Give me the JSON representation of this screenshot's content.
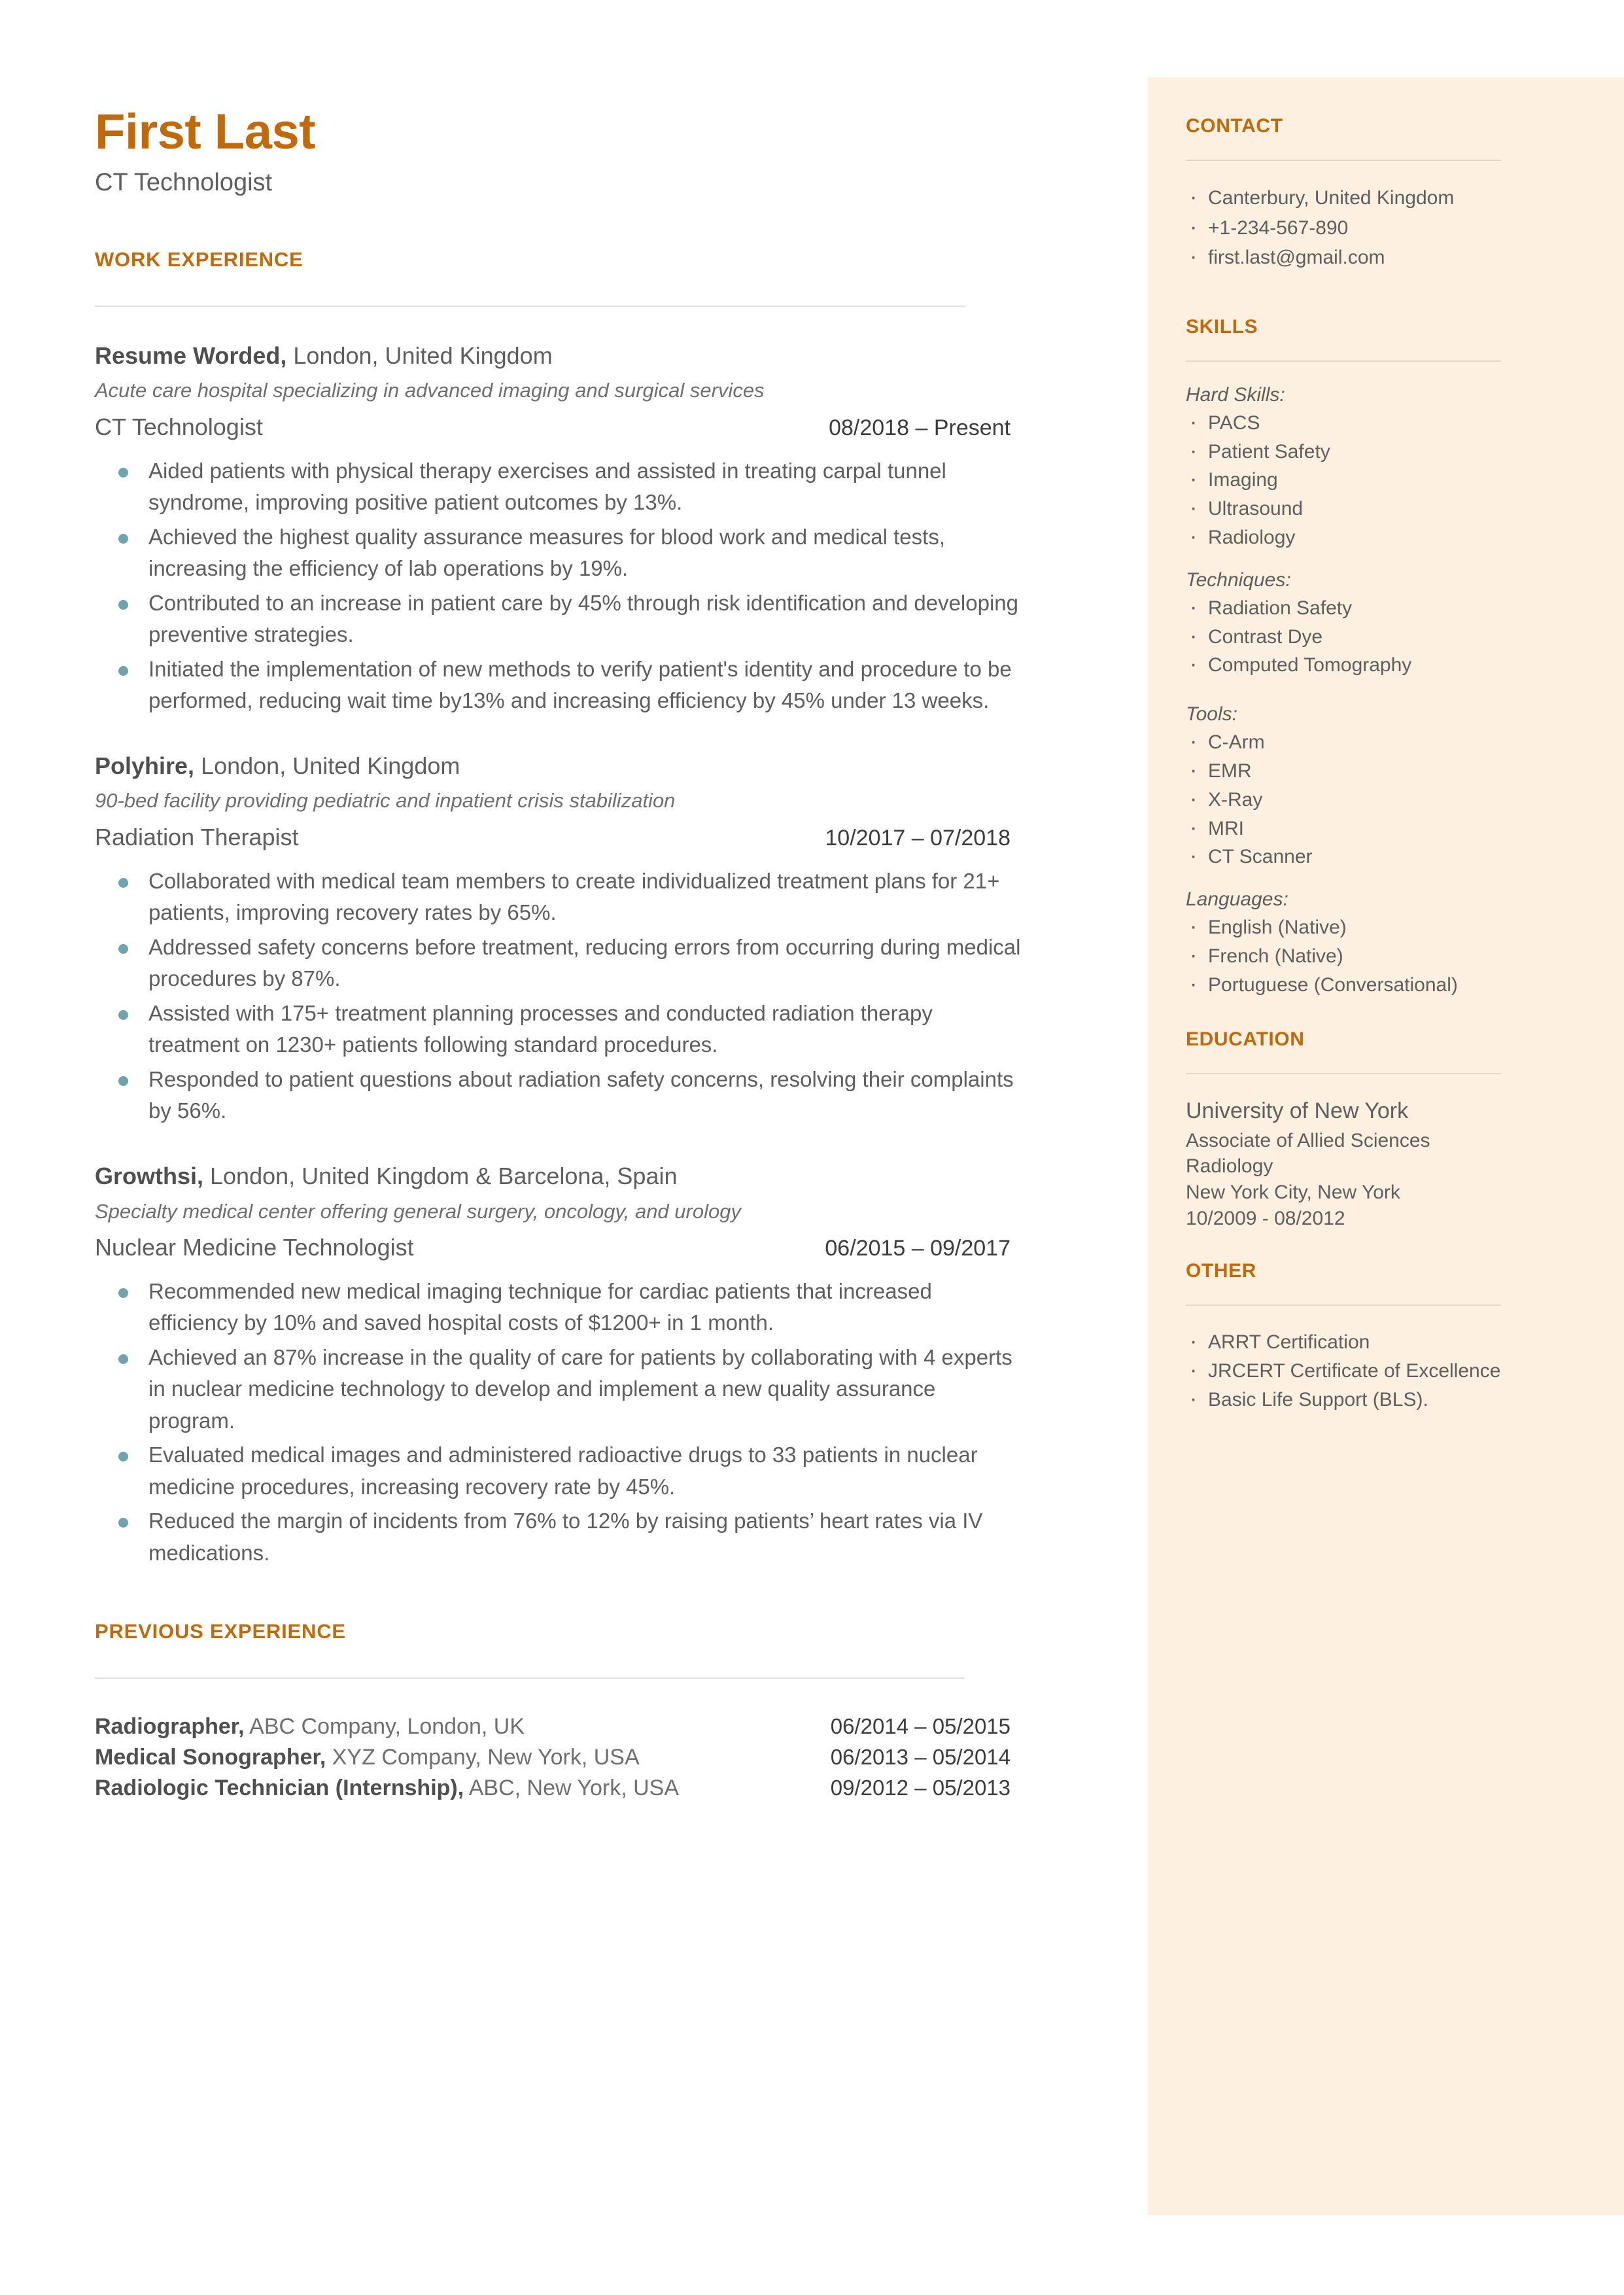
{
  "header": {
    "name": "First Last",
    "role": "CT Technologist"
  },
  "main": {
    "work_heading": "WORK EXPERIENCE",
    "previous_heading": "PREVIOUS EXPERIENCE",
    "jobs": [
      {
        "company": "Resume Worded,",
        "location": " London, United Kingdom",
        "description": "Acute care hospital specializing in advanced imaging and surgical services",
        "title": "CT Technologist",
        "dates": "08/2018 – Present",
        "bullets": [
          "Aided patients with physical therapy exercises and assisted in treating carpal tunnel syndrome, improving positive patient outcomes by 13%.",
          "Achieved the highest quality assurance measures for blood work and medical tests, increasing the efficiency of lab operations by 19%.",
          "Contributed to an increase in patient care by 45% through risk identification and developing preventive strategies.",
          "Initiated the implementation of new methods to verify patient's identity and procedure to be performed, reducing wait time by13% and increasing efficiency by 45% under 13 weeks."
        ]
      },
      {
        "company": "Polyhire,",
        "location": " London, United Kingdom",
        "description": "90-bed facility providing pediatric and inpatient crisis stabilization",
        "title": "Radiation Therapist",
        "dates": "10/2017 – 07/2018",
        "bullets": [
          "Collaborated with medical team members to create individualized treatment plans for 21+ patients, improving recovery rates by 65%.",
          "Addressed safety concerns before treatment, reducing errors from occurring during medical procedures by 87%.",
          "Assisted with 175+ treatment planning processes and conducted radiation therapy treatment on 1230+ patients following standard procedures.",
          "Responded to patient questions about radiation safety concerns, resolving their complaints by 56%."
        ]
      },
      {
        "company": "Growthsi,",
        "location": " London, United Kingdom & Barcelona, Spain",
        "description": "Specialty medical center offering general surgery, oncology, and urology",
        "title": "Nuclear Medicine Technologist",
        "dates": "06/2015 – 09/2017",
        "bullets": [
          "Recommended new medical imaging technique for cardiac patients that increased efficiency by 10% and saved hospital costs of $1200+ in 1 month.",
          "Achieved an 87% increase in the quality of care for patients by collaborating with 4 experts in nuclear medicine technology to develop and implement a new quality assurance program.",
          "Evaluated medical images and administered radioactive drugs to 33 patients in nuclear medicine procedures, increasing recovery rate by 45%.",
          "Reduced the margin of incidents from 76% to 12% by raising patients’ heart rates via IV medications."
        ]
      }
    ],
    "previous": [
      {
        "title": "Radiographer,",
        "detail": " ABC Company, London, UK",
        "dates": "06/2014 – 05/2015"
      },
      {
        "title": "Medical Sonographer,",
        "detail": " XYZ Company, New York, USA",
        "dates": "06/2013 – 05/2014"
      },
      {
        "title": "Radiologic Technician (Internship),",
        "detail": " ABC, New York, USA",
        "dates": "09/2012 – 05/2013"
      }
    ]
  },
  "sidebar": {
    "contact_heading": "CONTACT",
    "contact_items": [
      "Canterbury, United Kingdom",
      "+1-234-567-890",
      "first.last@gmail.com"
    ],
    "skills_heading": "SKILLS",
    "hard_skills_label": "Hard Skills:",
    "hard_skills": [
      "PACS",
      "Patient Safety",
      "Imaging",
      "Ultrasound",
      "Radiology"
    ],
    "techniques_label": "Techniques:",
    "techniques": [
      "Radiation Safety",
      "Contrast Dye",
      "Computed Tomography"
    ],
    "tools_label": "Tools:",
    "tools": [
      "C-Arm",
      "EMR",
      "X-Ray",
      "MRI",
      "CT Scanner"
    ],
    "languages_label": "Languages:",
    "languages": [
      "English (Native)",
      "French (Native)",
      "Portuguese (Conversational)"
    ],
    "education_heading": "EDUCATION",
    "education": {
      "school": "University of New York",
      "degree": "Associate of Allied Sciences",
      "field": "Radiology",
      "place": "New York City, New York",
      "dates": "10/2009  -  08/2012"
    },
    "other_heading": "OTHER",
    "other_items": [
      "ARRT Certification",
      "JRCERT Certificate of Excellence",
      "Basic Life Support (BLS)."
    ]
  },
  "colors": {
    "accent": "#C06A0C",
    "sidebar_bg": "#FDF0E0",
    "bullet": "#6FA3AE",
    "text": "#5E5E5E"
  }
}
